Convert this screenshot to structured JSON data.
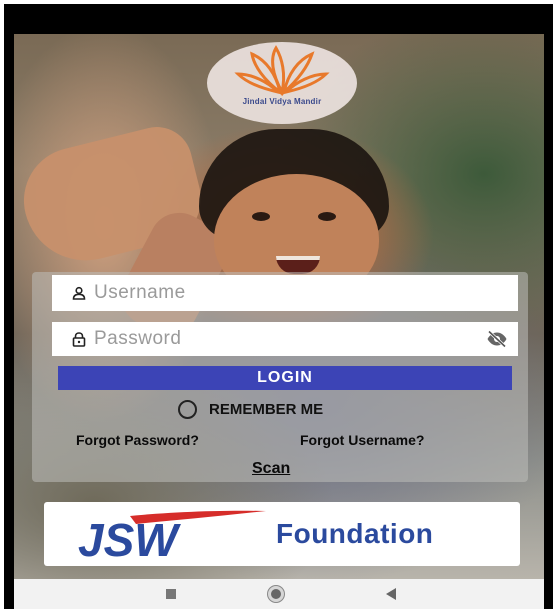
{
  "brand": {
    "logo_text": "Jindal Vidya Mandir",
    "accent_color": "#e8792b"
  },
  "login": {
    "username_placeholder": "Username",
    "username_value": "",
    "password_placeholder": "Password",
    "password_value": "",
    "login_label": "LOGIN",
    "remember_label": "REMEMBER ME",
    "remember_checked": false,
    "forgot_password": "Forgot Password?",
    "forgot_username": "Forgot Username?",
    "scan_label": "Scan",
    "button_color": "#3c44b6"
  },
  "sponsor": {
    "mark_text": "JSW",
    "name": "Foundation",
    "mark_color": "#2b4a9e",
    "swoosh_color": "#d62d2a"
  },
  "icons": {
    "username": "person-icon",
    "password": "lock-icon",
    "toggle": "eye-off-icon"
  }
}
